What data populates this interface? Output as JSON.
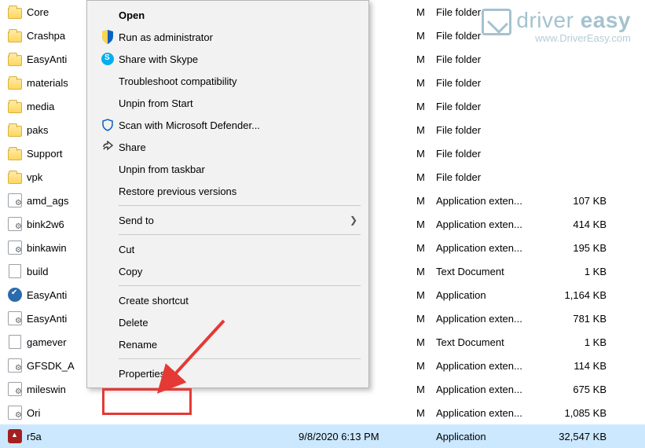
{
  "files": [
    {
      "icon": "folder",
      "name": "Core",
      "date": "",
      "type": "File folder",
      "size": ""
    },
    {
      "icon": "folder",
      "name": "Crashpa",
      "date": "",
      "type": "File folder",
      "size": ""
    },
    {
      "icon": "folder",
      "name": "EasyAnti",
      "date": "",
      "type": "File folder",
      "size": ""
    },
    {
      "icon": "folder",
      "name": "materials",
      "date": "",
      "type": "File folder",
      "size": ""
    },
    {
      "icon": "folder",
      "name": "media",
      "date": "",
      "type": "File folder",
      "size": ""
    },
    {
      "icon": "folder",
      "name": "paks",
      "date": "",
      "type": "File folder",
      "size": ""
    },
    {
      "icon": "folder",
      "name": "Support",
      "date": "",
      "type": "File folder",
      "size": ""
    },
    {
      "icon": "folder",
      "name": "vpk",
      "date": "",
      "type": "File folder",
      "size": ""
    },
    {
      "icon": "sys",
      "name": "amd_ags",
      "date": "",
      "type": "Application exten...",
      "size": "107 KB"
    },
    {
      "icon": "sys",
      "name": "bink2w6",
      "date": "",
      "type": "Application exten...",
      "size": "414 KB"
    },
    {
      "icon": "sys",
      "name": "binkawin",
      "date": "",
      "type": "Application exten...",
      "size": "195 KB"
    },
    {
      "icon": "txt",
      "name": "build",
      "date": "",
      "type": "Text Document",
      "size": "1 KB"
    },
    {
      "icon": "app",
      "name": "EasyAnti",
      "date": "",
      "type": "Application",
      "size": "1,164 KB"
    },
    {
      "icon": "sys",
      "name": "EasyAnti",
      "date": "",
      "type": "Application exten...",
      "size": "781 KB"
    },
    {
      "icon": "txt",
      "name": "gamever",
      "date": "",
      "type": "Text Document",
      "size": "1 KB"
    },
    {
      "icon": "sys",
      "name": "GFSDK_A",
      "date": "",
      "type": "Application exten...",
      "size": "114 KB"
    },
    {
      "icon": "sys",
      "name": "mileswin",
      "date": "",
      "type": "Application exten...",
      "size": "675 KB"
    },
    {
      "icon": "sys",
      "name": "Ori",
      "date": "",
      "type": "Application exten...",
      "size": "1,085 KB"
    },
    {
      "icon": "exe",
      "name": "r5a",
      "date": "9/8/2020 6:13 PM",
      "type": "Application",
      "size": "32,547 KB",
      "selected": true
    }
  ],
  "dateSuffix": "M",
  "menu": {
    "open": "Open",
    "runAdmin": "Run as administrator",
    "skype": "Share with Skype",
    "troubleshoot": "Troubleshoot compatibility",
    "unpinStart": "Unpin from Start",
    "defender": "Scan with Microsoft Defender...",
    "share": "Share",
    "unpinTaskbar": "Unpin from taskbar",
    "restore": "Restore previous versions",
    "sendTo": "Send to",
    "cut": "Cut",
    "copy": "Copy",
    "shortcut": "Create shortcut",
    "delete": "Delete",
    "rename": "Rename",
    "properties": "Properties"
  },
  "watermark": {
    "brand_a": "driver",
    "brand_b": "easy",
    "url": "www.DriverEasy.com"
  }
}
